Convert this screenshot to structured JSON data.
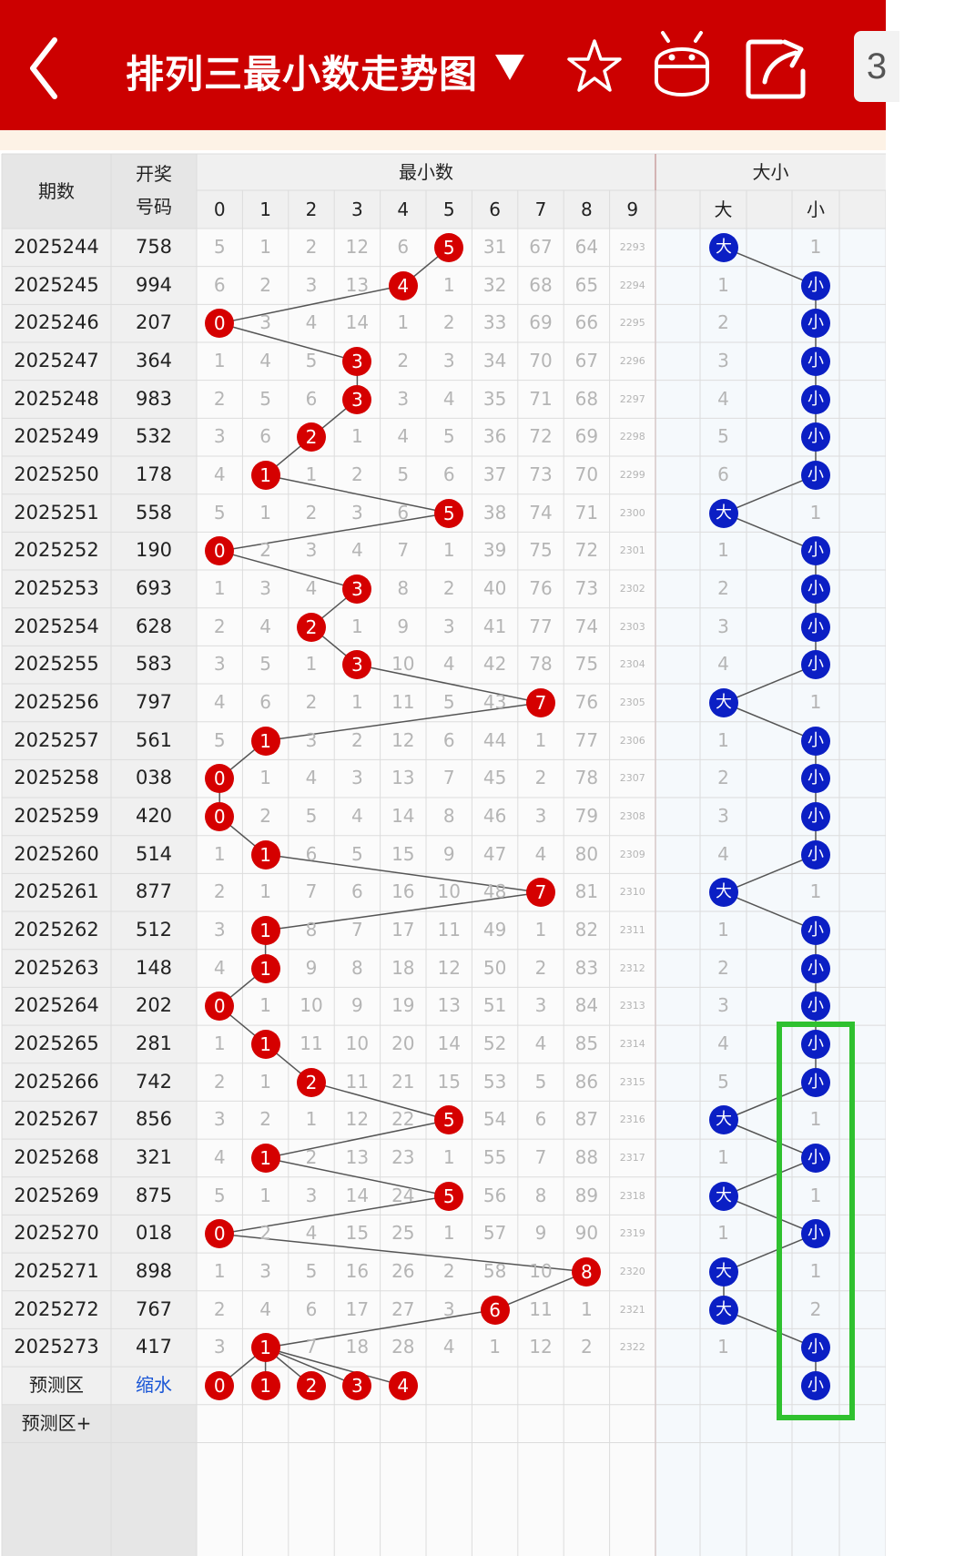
{
  "header": {
    "title": "排列三最小数走势图",
    "tab_peek": "3",
    "icons": [
      "back-icon",
      "dropdown-icon",
      "star-icon",
      "android-icon",
      "share-icon"
    ],
    "bg_color": "#cc0000"
  },
  "table": {
    "col_period": "期数",
    "col_draw_line1": "开奖",
    "col_draw_line2": "号码",
    "group_min": "最小数",
    "group_size": "大小",
    "digits": [
      "0",
      "1",
      "2",
      "3",
      "4",
      "5",
      "6",
      "7",
      "8",
      "9"
    ],
    "size_labels": [
      "大",
      "小"
    ],
    "rows": [
      {
        "issue": "2025244",
        "draw": "758",
        "min": 5,
        "miss": [
          "5",
          "1",
          "2",
          "12",
          "6",
          "",
          "31",
          "67",
          "64",
          "2293"
        ],
        "size": "大",
        "other": "1"
      },
      {
        "issue": "2025245",
        "draw": "994",
        "min": 4,
        "miss": [
          "6",
          "2",
          "3",
          "13",
          "",
          "1",
          "32",
          "68",
          "65",
          "2294"
        ],
        "size": "小",
        "other": "1"
      },
      {
        "issue": "2025246",
        "draw": "207",
        "min": 0,
        "miss": [
          "",
          "3",
          "4",
          "14",
          "1",
          "2",
          "33",
          "69",
          "66",
          "2295"
        ],
        "size": "小",
        "other": "2"
      },
      {
        "issue": "2025247",
        "draw": "364",
        "min": 3,
        "miss": [
          "1",
          "4",
          "5",
          "",
          "2",
          "3",
          "34",
          "70",
          "67",
          "2296"
        ],
        "size": "小",
        "other": "3"
      },
      {
        "issue": "2025248",
        "draw": "983",
        "min": 3,
        "miss": [
          "2",
          "5",
          "6",
          "",
          "3",
          "4",
          "35",
          "71",
          "68",
          "2297"
        ],
        "size": "小",
        "other": "4"
      },
      {
        "issue": "2025249",
        "draw": "532",
        "min": 2,
        "miss": [
          "3",
          "6",
          "",
          "1",
          "4",
          "5",
          "36",
          "72",
          "69",
          "2298"
        ],
        "size": "小",
        "other": "5"
      },
      {
        "issue": "2025250",
        "draw": "178",
        "min": 1,
        "miss": [
          "4",
          "",
          "1",
          "2",
          "5",
          "6",
          "37",
          "73",
          "70",
          "2299"
        ],
        "size": "小",
        "other": "6"
      },
      {
        "issue": "2025251",
        "draw": "558",
        "min": 5,
        "miss": [
          "5",
          "1",
          "2",
          "3",
          "6",
          "",
          "38",
          "74",
          "71",
          "2300"
        ],
        "size": "大",
        "other": "1"
      },
      {
        "issue": "2025252",
        "draw": "190",
        "min": 0,
        "miss": [
          "",
          "2",
          "3",
          "4",
          "7",
          "1",
          "39",
          "75",
          "72",
          "2301"
        ],
        "size": "小",
        "other": "1"
      },
      {
        "issue": "2025253",
        "draw": "693",
        "min": 3,
        "miss": [
          "1",
          "3",
          "4",
          "",
          "8",
          "2",
          "40",
          "76",
          "73",
          "2302"
        ],
        "size": "小",
        "other": "2"
      },
      {
        "issue": "2025254",
        "draw": "628",
        "min": 2,
        "miss": [
          "2",
          "4",
          "",
          "1",
          "9",
          "3",
          "41",
          "77",
          "74",
          "2303"
        ],
        "size": "小",
        "other": "3"
      },
      {
        "issue": "2025255",
        "draw": "583",
        "min": 3,
        "miss": [
          "3",
          "5",
          "1",
          "",
          "10",
          "4",
          "42",
          "78",
          "75",
          "2304"
        ],
        "size": "小",
        "other": "4"
      },
      {
        "issue": "2025256",
        "draw": "797",
        "min": 7,
        "miss": [
          "4",
          "6",
          "2",
          "1",
          "11",
          "5",
          "43",
          "",
          "76",
          "2305"
        ],
        "size": "大",
        "other": "1"
      },
      {
        "issue": "2025257",
        "draw": "561",
        "min": 1,
        "miss": [
          "5",
          "",
          "3",
          "2",
          "12",
          "6",
          "44",
          "1",
          "77",
          "2306"
        ],
        "size": "小",
        "other": "1"
      },
      {
        "issue": "2025258",
        "draw": "038",
        "min": 0,
        "miss": [
          "",
          "1",
          "4",
          "3",
          "13",
          "7",
          "45",
          "2",
          "78",
          "2307"
        ],
        "size": "小",
        "other": "2"
      },
      {
        "issue": "2025259",
        "draw": "420",
        "min": 0,
        "miss": [
          "",
          "2",
          "5",
          "4",
          "14",
          "8",
          "46",
          "3",
          "79",
          "2308"
        ],
        "size": "小",
        "other": "3"
      },
      {
        "issue": "2025260",
        "draw": "514",
        "min": 1,
        "miss": [
          "1",
          "",
          "6",
          "5",
          "15",
          "9",
          "47",
          "4",
          "80",
          "2309"
        ],
        "size": "小",
        "other": "4"
      },
      {
        "issue": "2025261",
        "draw": "877",
        "min": 7,
        "miss": [
          "2",
          "1",
          "7",
          "6",
          "16",
          "10",
          "48",
          "",
          "81",
          "2310"
        ],
        "size": "大",
        "other": "1"
      },
      {
        "issue": "2025262",
        "draw": "512",
        "min": 1,
        "miss": [
          "3",
          "",
          "8",
          "7",
          "17",
          "11",
          "49",
          "1",
          "82",
          "2311"
        ],
        "size": "小",
        "other": "1"
      },
      {
        "issue": "2025263",
        "draw": "148",
        "min": 1,
        "miss": [
          "4",
          "",
          "9",
          "8",
          "18",
          "12",
          "50",
          "2",
          "83",
          "2312"
        ],
        "size": "小",
        "other": "2"
      },
      {
        "issue": "2025264",
        "draw": "202",
        "min": 0,
        "miss": [
          "",
          "1",
          "10",
          "9",
          "19",
          "13",
          "51",
          "3",
          "84",
          "2313"
        ],
        "size": "小",
        "other": "3"
      },
      {
        "issue": "2025265",
        "draw": "281",
        "min": 1,
        "miss": [
          "1",
          "",
          "11",
          "10",
          "20",
          "14",
          "52",
          "4",
          "85",
          "2314"
        ],
        "size": "小",
        "other": "4"
      },
      {
        "issue": "2025266",
        "draw": "742",
        "min": 2,
        "miss": [
          "2",
          "1",
          "",
          "11",
          "21",
          "15",
          "53",
          "5",
          "86",
          "2315"
        ],
        "size": "小",
        "other": "5"
      },
      {
        "issue": "2025267",
        "draw": "856",
        "min": 5,
        "miss": [
          "3",
          "2",
          "1",
          "12",
          "22",
          "",
          "54",
          "6",
          "87",
          "2316"
        ],
        "size": "大",
        "other": "1"
      },
      {
        "issue": "2025268",
        "draw": "321",
        "min": 1,
        "miss": [
          "4",
          "",
          "2",
          "13",
          "23",
          "1",
          "55",
          "7",
          "88",
          "2317"
        ],
        "size": "小",
        "other": "1"
      },
      {
        "issue": "2025269",
        "draw": "875",
        "min": 5,
        "miss": [
          "5",
          "1",
          "3",
          "14",
          "24",
          "",
          "56",
          "8",
          "89",
          "2318"
        ],
        "size": "大",
        "other": "1"
      },
      {
        "issue": "2025270",
        "draw": "018",
        "min": 0,
        "miss": [
          "",
          "2",
          "4",
          "15",
          "25",
          "1",
          "57",
          "9",
          "90",
          "2319"
        ],
        "size": "小",
        "other": "1"
      },
      {
        "issue": "2025271",
        "draw": "898",
        "min": 8,
        "miss": [
          "1",
          "3",
          "5",
          "16",
          "26",
          "2",
          "58",
          "10",
          "",
          "2320"
        ],
        "size": "大",
        "other": "1"
      },
      {
        "issue": "2025272",
        "draw": "767",
        "min": 6,
        "miss": [
          "2",
          "4",
          "6",
          "17",
          "27",
          "3",
          "",
          "11",
          "1",
          "2321"
        ],
        "size": "大",
        "other": "2"
      },
      {
        "issue": "2025273",
        "draw": "417",
        "min": 1,
        "miss": [
          "3",
          "",
          "7",
          "18",
          "28",
          "4",
          "1",
          "12",
          "2",
          "2322"
        ],
        "size": "小",
        "other": "1"
      }
    ],
    "prediction": {
      "label": "预测区",
      "shrink": "缩水",
      "balls": [
        "0",
        "1",
        "2",
        "3",
        "4"
      ],
      "size": "小"
    },
    "prediction_plus": "预测区+"
  },
  "colors": {
    "red_ball": "#d50000",
    "blue_ball": "#0b1fc4",
    "highlight": "#2fc12f",
    "header_bg": "#cc0000"
  }
}
